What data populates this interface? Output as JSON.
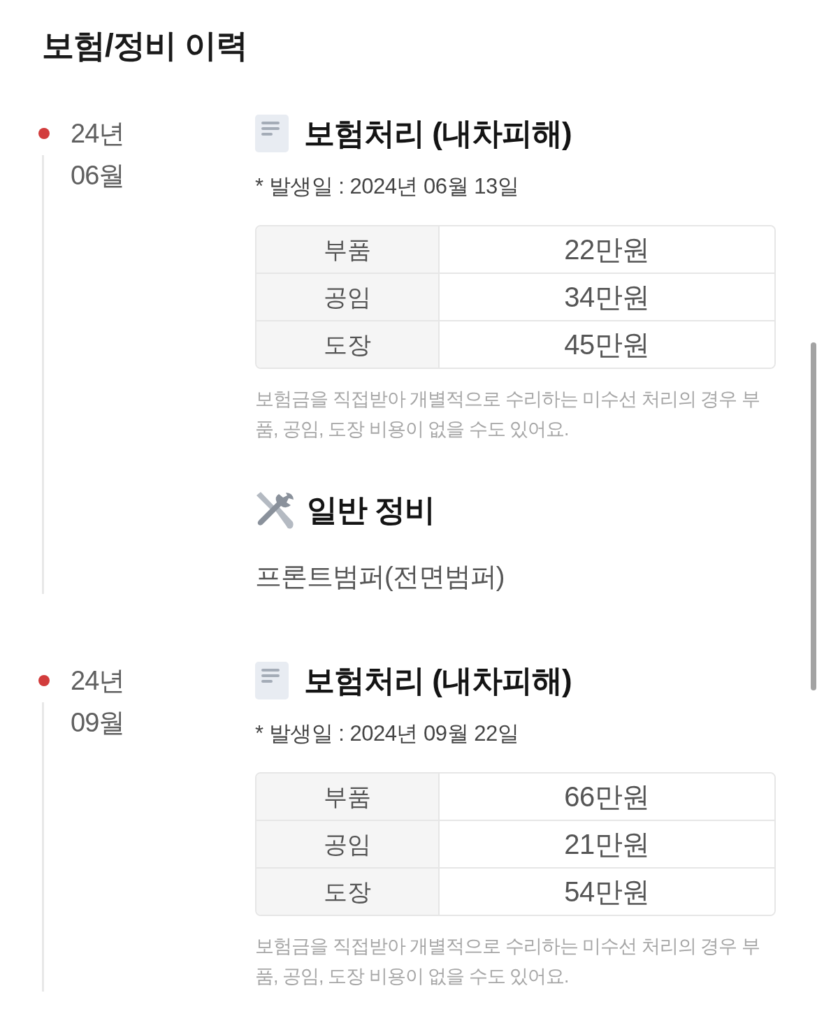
{
  "title": "보험/정비 이력",
  "entries": [
    {
      "year": "24년",
      "month": "06월",
      "records": [
        {
          "kind": "insurance",
          "title": "보험처리 (내차피해)",
          "date": "* 발생일 : 2024년 06월 13일",
          "costs": [
            {
              "label": "부품",
              "value": "22만원"
            },
            {
              "label": "공임",
              "value": "34만원"
            },
            {
              "label": "도장",
              "value": "45만원"
            }
          ],
          "note": "보험금을 직접받아 개별적으로 수리하는 미수선 처리의 경우 부품, 공임, 도장 비용이 없을 수도 있어요."
        },
        {
          "kind": "maintenance",
          "title": "일반 정비",
          "items": [
            "프론트범퍼(전면범퍼)"
          ]
        }
      ]
    },
    {
      "year": "24년",
      "month": "09월",
      "records": [
        {
          "kind": "insurance",
          "title": "보험처리 (내차피해)",
          "date": "* 발생일 : 2024년 09월 22일",
          "costs": [
            {
              "label": "부품",
              "value": "66만원"
            },
            {
              "label": "공임",
              "value": "21만원"
            },
            {
              "label": "도장",
              "value": "54만원"
            }
          ],
          "note": "보험금을 직접받아 개별적으로 수리하는 미수선 처리의 경우 부품, 공임, 도장 비용이 없을 수도 있어요."
        }
      ]
    }
  ]
}
